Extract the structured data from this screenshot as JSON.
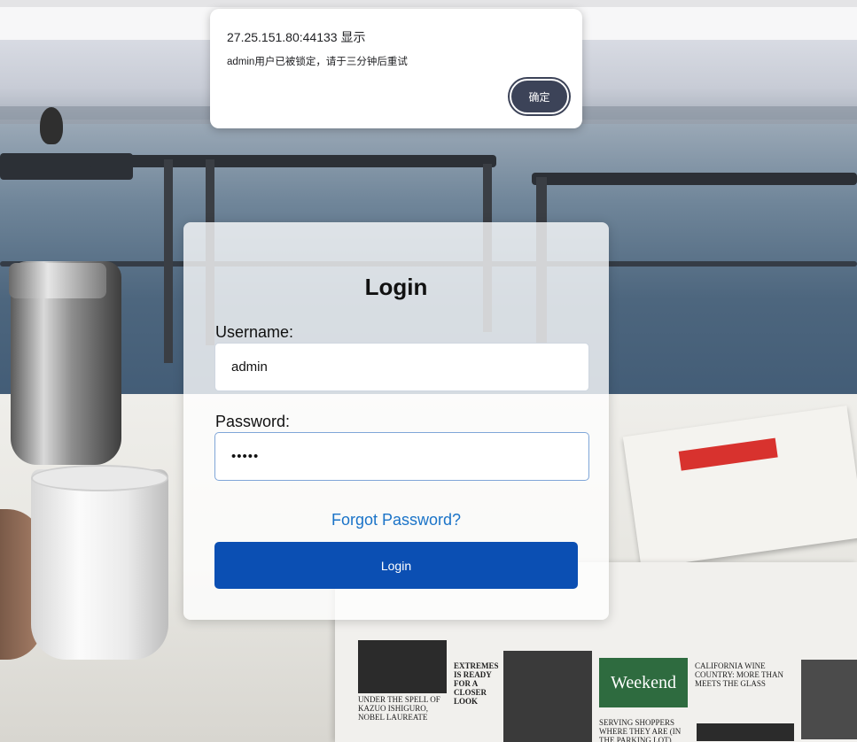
{
  "dialog": {
    "title": "27.25.151.80:44133 显示",
    "message": "admin用户已被锁定，请于三分钟后重试",
    "ok_label": "确定"
  },
  "login": {
    "title": "Login",
    "username_label": "Username:",
    "username_value": "admin",
    "password_label": "Password:",
    "password_value": "•••••",
    "forgot_label": "Forgot Password?",
    "submit_label": "Login"
  },
  "newspaper": {
    "col1": "UNDER THE SPELL OF KAZUO ISHIGURO, NOBEL LAUREATE",
    "col2": "EXTREMES IS READY FOR A CLOSER LOOK",
    "weekend": "Weekend",
    "col3": "SERVING SHOPPERS WHERE THEY ARE (IN THE PARKING LOT)",
    "col4": "CALIFORNIA WINE COUNTRY: MORE THAN MEETS THE GLASS"
  },
  "colors": {
    "accent": "#0b4fb3",
    "link": "#1a73c8",
    "dialog_button": "#3c4358"
  }
}
